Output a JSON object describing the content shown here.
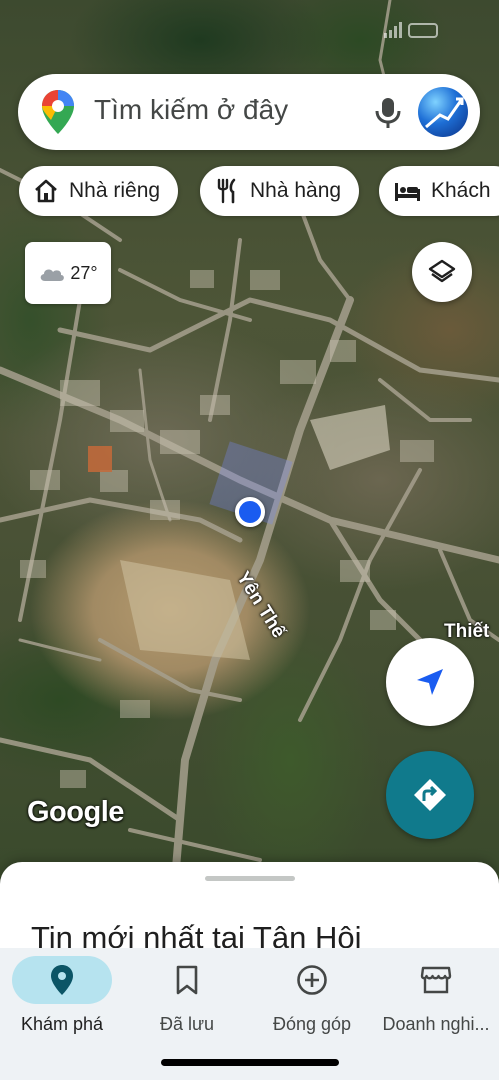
{
  "search": {
    "placeholder": "Tìm kiếm ở đây"
  },
  "chips": [
    {
      "label": "Nhà riêng",
      "icon": "home-icon"
    },
    {
      "label": "Nhà hàng",
      "icon": "restaurant-icon"
    },
    {
      "label": "Khách",
      "icon": "hotel-icon"
    }
  ],
  "weather": {
    "temperature": "27°",
    "icon": "cloud-icon"
  },
  "map": {
    "road_labels": [
      "Yên Thế",
      "Thiết"
    ],
    "attribution": "Google"
  },
  "sheet": {
    "title": "Tin mới nhất tại Tân Hội"
  },
  "nav": [
    {
      "label": "Khám phá",
      "icon": "location-pin-icon",
      "active": true
    },
    {
      "label": "Đã lưu",
      "icon": "bookmark-icon",
      "active": false
    },
    {
      "label": "Đóng góp",
      "icon": "add-circle-icon",
      "active": false
    },
    {
      "label": "Doanh nghi...",
      "icon": "storefront-icon",
      "active": false
    }
  ],
  "colors": {
    "accent": "#107a8c",
    "active_tab_bg": "#b6e3ef",
    "location_dot": "#1a5cf0"
  }
}
